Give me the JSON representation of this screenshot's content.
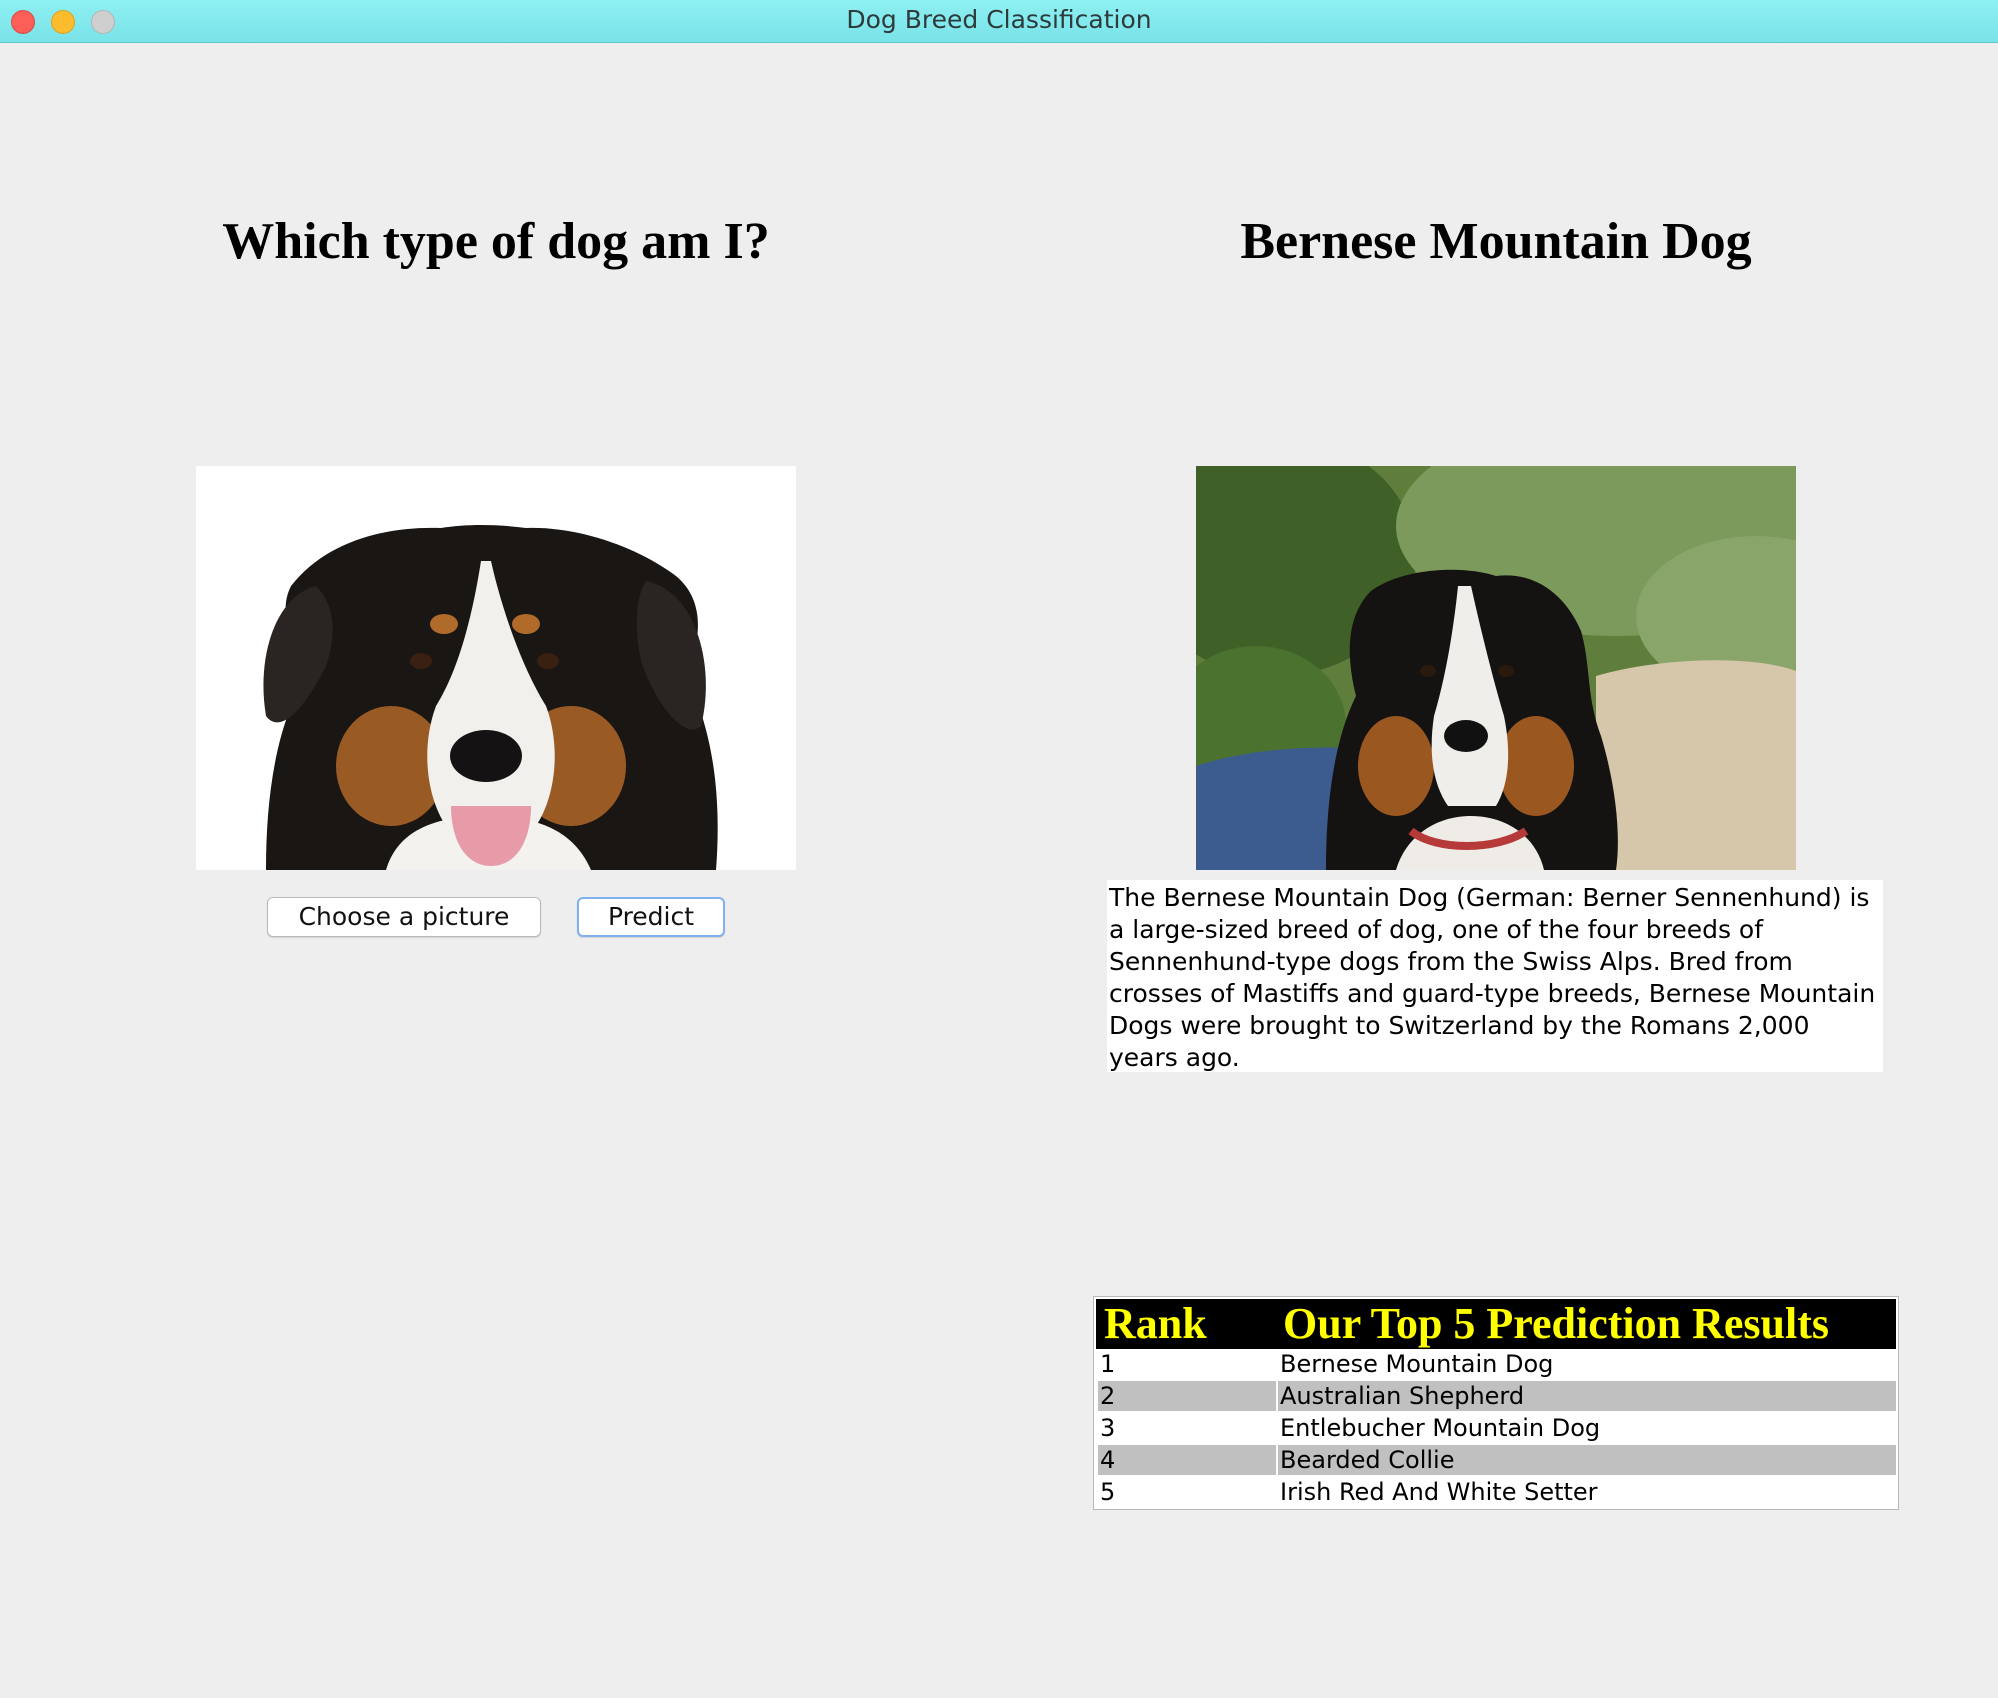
{
  "window": {
    "title": "Dog Breed Classification"
  },
  "left_panel": {
    "heading": "Which type of dog am I?",
    "choose_button": "Choose a picture",
    "predict_button": "Predict"
  },
  "right_panel": {
    "heading": "Bernese Mountain Dog",
    "description": "The Bernese Mountain Dog (German: Berner Sennenhund) is a large-sized breed of dog, one of the four breeds of Sennenhund-type dogs from the Swiss Alps. Bred from crosses of Mastiffs and guard-type breeds, Bernese Mountain Dogs were brought to Switzerland by the Romans 2,000 years ago."
  },
  "results": {
    "rank_header": "Rank",
    "title_header": "Our Top 5 Prediction Results",
    "rows": [
      {
        "rank": "1",
        "breed": "Bernese Mountain Dog"
      },
      {
        "rank": "2",
        "breed": "Australian Shepherd"
      },
      {
        "rank": "3",
        "breed": "Entlebucher Mountain Dog"
      },
      {
        "rank": "4",
        "breed": "Bearded Collie"
      },
      {
        "rank": "5",
        "breed": "Irish Red And White Setter"
      }
    ]
  },
  "colors": {
    "titlebar": "#8ef0f2",
    "header_bg": "#000000",
    "header_text": "#ffff00",
    "alt_row": "#c0c0c0",
    "predict_focus": "#7fb1ee"
  }
}
